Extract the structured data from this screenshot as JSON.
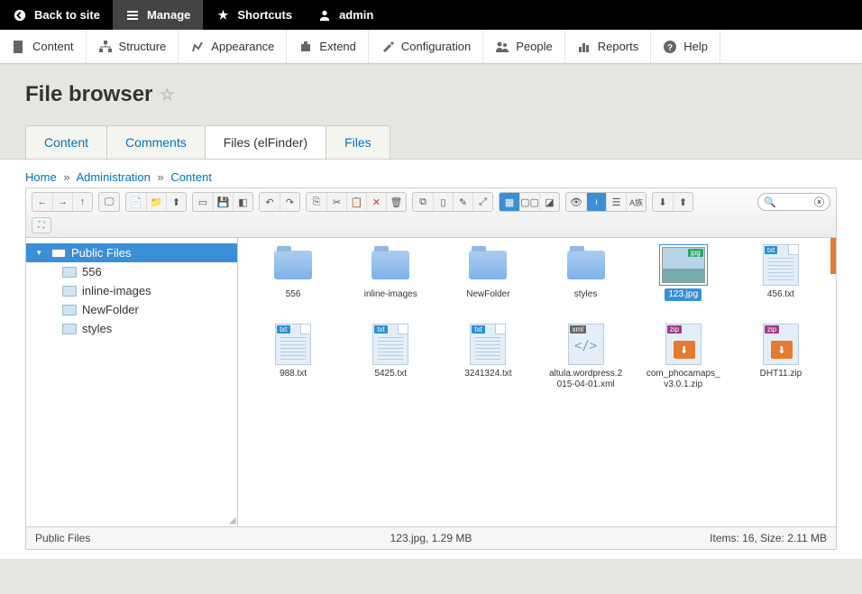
{
  "topbar": {
    "back": "Back to site",
    "manage": "Manage",
    "shortcuts": "Shortcuts",
    "user": "admin"
  },
  "adminmenu": [
    {
      "icon": "content",
      "label": "Content"
    },
    {
      "icon": "structure",
      "label": "Structure"
    },
    {
      "icon": "appearance",
      "label": "Appearance"
    },
    {
      "icon": "extend",
      "label": "Extend"
    },
    {
      "icon": "config",
      "label": "Configuration"
    },
    {
      "icon": "people",
      "label": "People"
    },
    {
      "icon": "reports",
      "label": "Reports"
    },
    {
      "icon": "help",
      "label": "Help"
    }
  ],
  "page_title": "File browser",
  "tabs": [
    {
      "label": "Content",
      "active": false
    },
    {
      "label": "Comments",
      "active": false
    },
    {
      "label": "Files (elFinder)",
      "active": true
    },
    {
      "label": "Files",
      "active": false
    }
  ],
  "breadcrumb": [
    {
      "label": "Home"
    },
    {
      "label": "Administration"
    },
    {
      "label": "Content"
    }
  ],
  "tree": {
    "root": "Public Files",
    "children": [
      "556",
      "inline-images",
      "NewFolder",
      "styles"
    ]
  },
  "files": [
    {
      "type": "folder",
      "name": "556"
    },
    {
      "type": "folder",
      "name": "inline-images"
    },
    {
      "type": "folder",
      "name": "NewFolder"
    },
    {
      "type": "folder",
      "name": "styles"
    },
    {
      "type": "jpg",
      "name": "123.jpg",
      "selected": true
    },
    {
      "type": "txt",
      "name": "456.txt"
    },
    {
      "type": "txt",
      "name": "988.txt"
    },
    {
      "type": "txt",
      "name": "5425.txt"
    },
    {
      "type": "txt",
      "name": "3241324.txt"
    },
    {
      "type": "xml",
      "name": "altula.wordpress.2015-04-01.xml"
    },
    {
      "type": "zip",
      "name": "com_phocamaps_v3.0.1.zip"
    },
    {
      "type": "zip",
      "name": "DHT11.zip"
    }
  ],
  "status": {
    "path": "Public Files",
    "selection": "123.jpg, 1.29 MB",
    "summary": "Items: 16, Size: 2.11 MB"
  },
  "search_placeholder": ""
}
